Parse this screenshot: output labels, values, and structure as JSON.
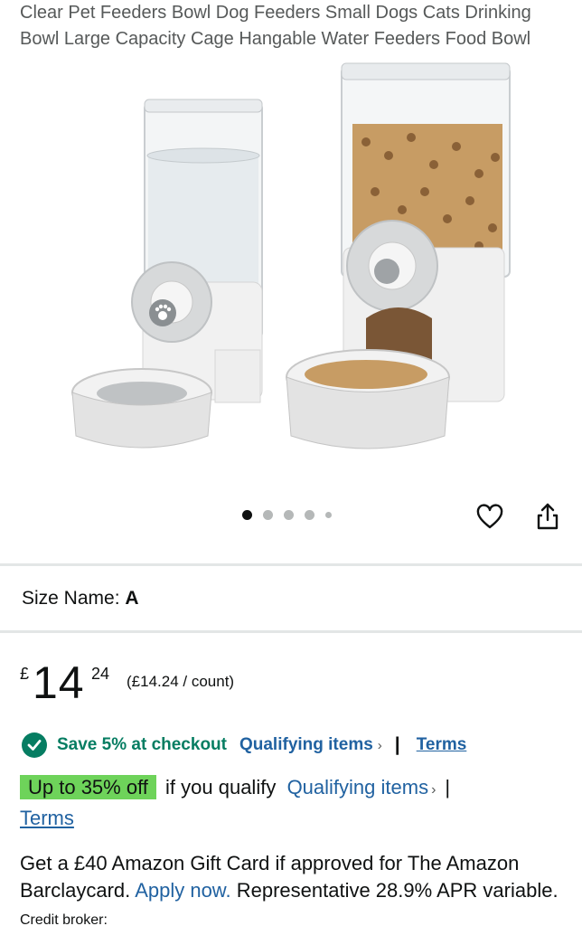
{
  "product": {
    "title": "Clear Pet Feeders Bowl Dog Feeders Small Dogs Cats Drinking Bowl Large Capacity Cage Hangable Water Feeders Food Bowl"
  },
  "gallery": {
    "image_count": 5,
    "active_index": 0
  },
  "actions": {
    "wishlist_icon": "heart-icon",
    "share_icon": "share-icon"
  },
  "variant": {
    "label": "Size Name:",
    "value": "A"
  },
  "price": {
    "currency": "£",
    "whole": "14",
    "fraction": "24",
    "unit_price": "(£14.24 / count)"
  },
  "promo": {
    "save_text": "Save 5% at checkout",
    "qualifying_link": "Qualifying items",
    "separator": "|",
    "terms_link": "Terms"
  },
  "offer": {
    "badge": "Up to 35% off",
    "text": "if you qualify",
    "qualifying_link": "Qualifying items",
    "separator": "|",
    "terms_link": "Terms"
  },
  "credit": {
    "line1": "Get a £40 Amazon Gift Card if approved for The Amazon Barclaycard.",
    "apply_link": "Apply now.",
    "line2": "Representative 28.9% APR variable.",
    "broker": "Credit broker:"
  },
  "colors": {
    "link": "#2162a1",
    "savings_green": "#067d62",
    "badge_green": "#6ed35a",
    "text": "#0f1111",
    "muted": "#565959"
  }
}
